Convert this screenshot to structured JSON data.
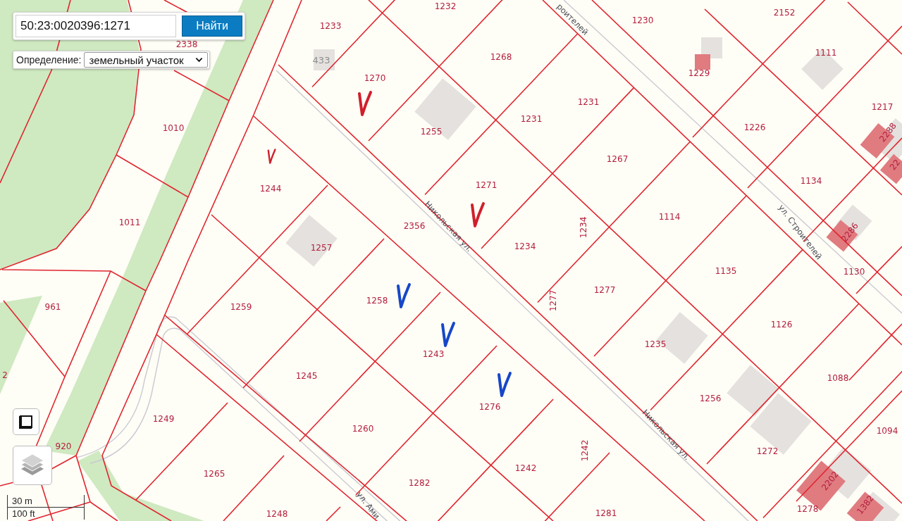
{
  "search": {
    "value": "50:23:0020396:1271",
    "button": "Найти"
  },
  "definition": {
    "label": "Определение:",
    "value": "земельный участок"
  },
  "labels": [
    {
      "text": "2338",
      "kind": "parcel"
    },
    {
      "text": "1232",
      "kind": "parcel"
    },
    {
      "text": "1233",
      "kind": "parcel"
    },
    {
      "text": "433",
      "kind": "building"
    },
    {
      "text": "1230",
      "kind": "parcel"
    },
    {
      "text": "2152",
      "kind": "parcel"
    },
    {
      "text": "1268",
      "kind": "parcel"
    },
    {
      "text": "1270",
      "kind": "parcel"
    },
    {
      "text": "1229",
      "kind": "parcel"
    },
    {
      "text": "1111",
      "kind": "parcel"
    },
    {
      "text": "1010",
      "kind": "parcel"
    },
    {
      "text": "1231",
      "kind": "parcel"
    },
    {
      "text": "1255",
      "kind": "parcel"
    },
    {
      "text": "1231",
      "kind": "parcel"
    },
    {
      "text": "1217",
      "kind": "parcel"
    },
    {
      "text": "1226",
      "kind": "parcel"
    },
    {
      "text": "1267",
      "kind": "parcel"
    },
    {
      "text": "2288",
      "kind": "parcel"
    },
    {
      "text": "1244",
      "kind": "parcel"
    },
    {
      "text": "1271",
      "kind": "parcel"
    },
    {
      "text": "22",
      "kind": "parcel"
    },
    {
      "text": "1134",
      "kind": "parcel"
    },
    {
      "text": "1011",
      "kind": "parcel"
    },
    {
      "text": "2356",
      "kind": "parcel"
    },
    {
      "text": "1114",
      "kind": "parcel"
    },
    {
      "text": "1257",
      "kind": "parcel"
    },
    {
      "text": "1234",
      "kind": "parcel"
    },
    {
      "text": "1234",
      "kind": "parcel"
    },
    {
      "text": "2286",
      "kind": "parcel"
    },
    {
      "text": "1130",
      "kind": "parcel"
    },
    {
      "text": "1135",
      "kind": "parcel"
    },
    {
      "text": "961",
      "kind": "parcel"
    },
    {
      "text": "1259",
      "kind": "parcel"
    },
    {
      "text": "1258",
      "kind": "parcel"
    },
    {
      "text": "1277",
      "kind": "parcel"
    },
    {
      "text": "1277",
      "kind": "parcel"
    },
    {
      "text": "1126",
      "kind": "parcel"
    },
    {
      "text": "1243",
      "kind": "parcel"
    },
    {
      "text": "1235",
      "kind": "parcel"
    },
    {
      "text": "2",
      "kind": "parcel"
    },
    {
      "text": "1245",
      "kind": "parcel"
    },
    {
      "text": "1088",
      "kind": "parcel"
    },
    {
      "text": "1256",
      "kind": "parcel"
    },
    {
      "text": "1276",
      "kind": "parcel"
    },
    {
      "text": "1249",
      "kind": "parcel"
    },
    {
      "text": "1260",
      "kind": "parcel"
    },
    {
      "text": "1094",
      "kind": "parcel"
    },
    {
      "text": "1242",
      "kind": "parcel"
    },
    {
      "text": "920",
      "kind": "parcel"
    },
    {
      "text": "1272",
      "kind": "parcel"
    },
    {
      "text": "1242",
      "kind": "parcel"
    },
    {
      "text": "1265",
      "kind": "parcel"
    },
    {
      "text": "1282",
      "kind": "parcel"
    },
    {
      "text": "1278",
      "kind": "parcel"
    },
    {
      "text": "2202",
      "kind": "parcel"
    },
    {
      "text": "1382",
      "kind": "parcel"
    },
    {
      "text": "1281",
      "kind": "parcel"
    },
    {
      "text": "1248",
      "kind": "parcel"
    }
  ],
  "streets": [
    {
      "text": "Никольская ул."
    },
    {
      "text": "Никольская ул."
    },
    {
      "text": "ул. Строителей"
    },
    {
      "text": "роителей"
    },
    {
      "text": "ул. Ами"
    }
  ],
  "check_marks": [
    {
      "color": "#d01f2c"
    },
    {
      "color": "#d01f2c"
    },
    {
      "color": "#d01f2c"
    },
    {
      "color": "#1747c8"
    },
    {
      "color": "#1747c8"
    },
    {
      "color": "#1747c8"
    }
  ],
  "scale": {
    "metric": "30 m",
    "imperial": "100 ft"
  }
}
